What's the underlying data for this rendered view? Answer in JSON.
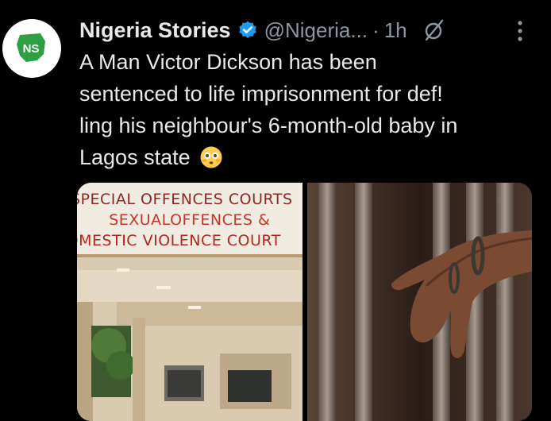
{
  "tweet": {
    "author_name": "Nigeria Stories",
    "handle": "@Nigeria...",
    "separator": "·",
    "time": "1h",
    "avatar_text": "NS",
    "text_lines": [
      "A Man Victor Dickson has been",
      "sentenced to life imprisonment for def!",
      "ling his neighbour's 6-month-old baby in",
      "Lagos state"
    ],
    "emoji": "flushed-face",
    "icons": {
      "verified": "verified-badge-icon",
      "grok": "grok-icon",
      "more": "more-options-icon"
    }
  },
  "media": {
    "photo1_sign": [
      "SPECIAL OFFENCES COURTS",
      "SEXUALOFFENCES &",
      "OMESTIC VIOLENCE COURT"
    ]
  },
  "colors": {
    "background": "#000000",
    "text": "#e7e9ea",
    "secondary": "#8b98a5",
    "verified": "#1d9bf0",
    "sign_red": "#b3261e",
    "brand_green": "#2ea043"
  }
}
